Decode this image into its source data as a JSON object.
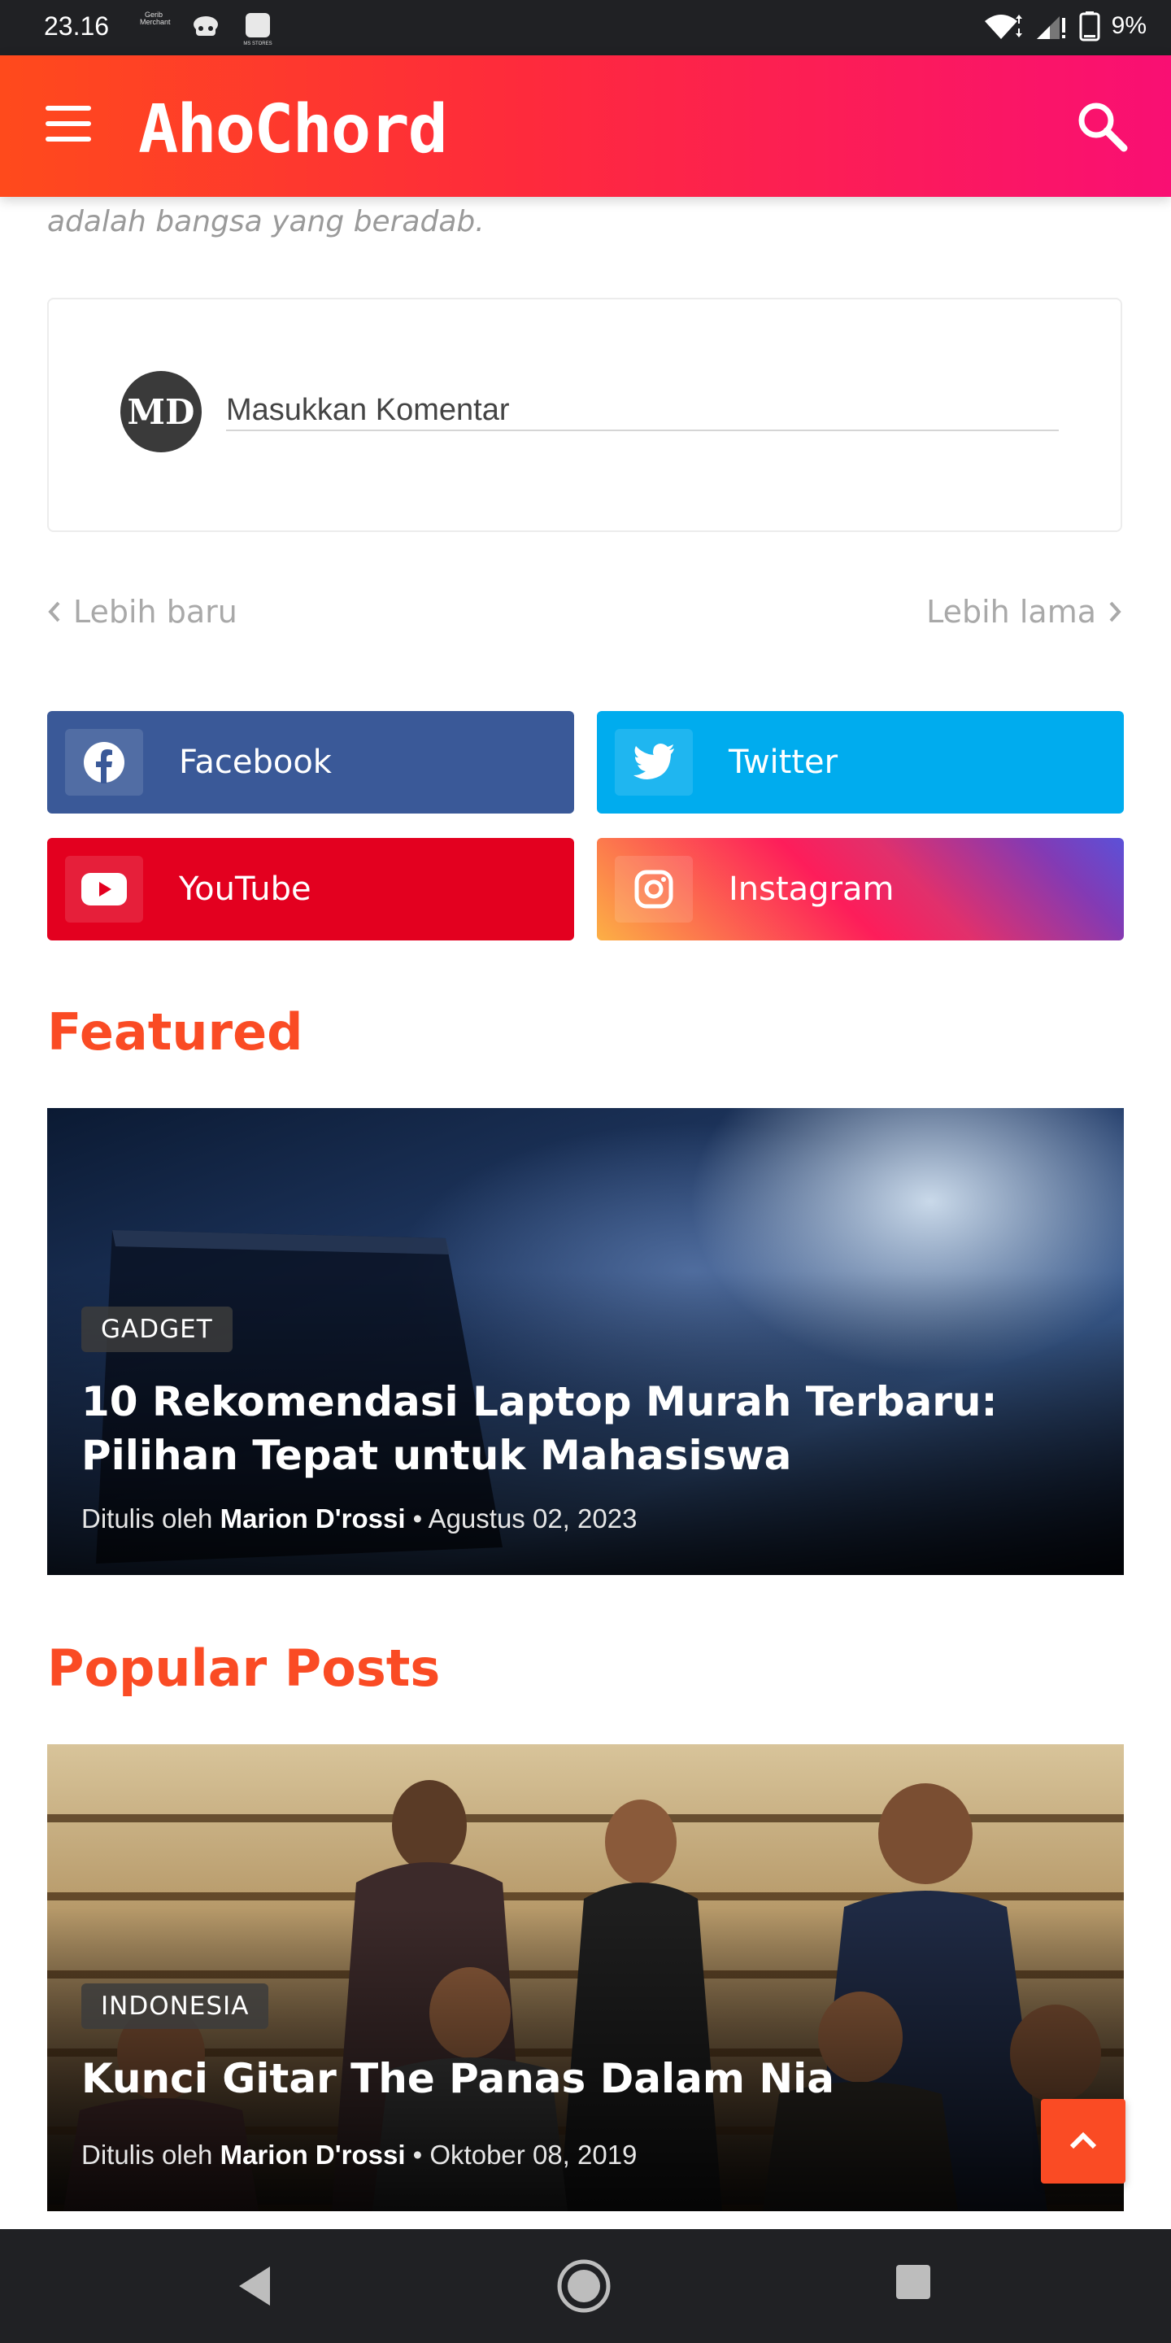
{
  "status_bar": {
    "time": "23.16",
    "notif_1": "Gerib Merchant",
    "notif_3": "MS STORES",
    "battery": "9%"
  },
  "header": {
    "brand": "AhoChord",
    "icons": [
      "menu-icon",
      "search-icon"
    ]
  },
  "article": {
    "closing_line": "adalah bangsa yang beradab."
  },
  "comment": {
    "avatar_initials": "MD",
    "placeholder": "Masukkan Komentar"
  },
  "pager": {
    "newer": "Lebih baru",
    "older": "Lebih lama"
  },
  "social": [
    {
      "label": "Facebook",
      "icon": "facebook-icon",
      "color": "#3a5998"
    },
    {
      "label": "Twitter",
      "icon": "twitter-icon",
      "color": "#00acee"
    },
    {
      "label": "YouTube",
      "icon": "youtube-icon",
      "color": "#e3001f"
    },
    {
      "label": "Instagram",
      "icon": "instagram-icon",
      "color": "#e1306c"
    }
  ],
  "featured": {
    "heading": "Featured",
    "category": "GADGET",
    "title": "10 Rekomendasi Laptop Murah Terbaru: Pilihan Tepat untuk Mahasiswa",
    "by_label": "Ditulis oleh",
    "author": "Marion D'rossi",
    "date": "Agustus 02, 2023"
  },
  "popular": {
    "heading": "Popular Posts",
    "category": "INDONESIA",
    "title": "Kunci Gitar The Panas Dalam Nia",
    "by_label": "Ditulis oleh",
    "author": "Marion D'rossi",
    "date": "Oktober 08, 2019"
  },
  "colors": {
    "accent": "#fa4b24",
    "header_gradient_start": "#ff4a1c",
    "header_gradient_end": "#f90f73"
  }
}
